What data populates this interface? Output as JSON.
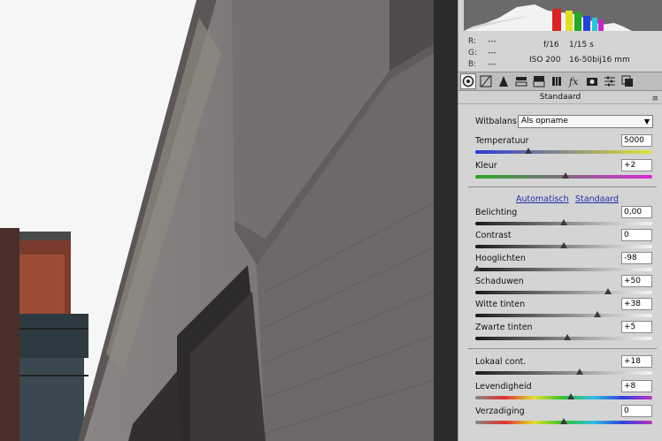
{
  "info": {
    "r_label": "R:",
    "g_label": "G:",
    "b_label": "B:",
    "r_val": "---",
    "g_val": "---",
    "b_val": "---",
    "aperture": "f/16",
    "shutter": "1/15 s",
    "iso": "ISO 200",
    "lens": "16-50bij16 mm"
  },
  "toolbar": {
    "icons": [
      "basic-icon",
      "tone-curve-icon",
      "detail-icon",
      "hsl-icon",
      "split-toning-icon",
      "lens-corrections-icon",
      "effects-icon",
      "camera-calibration-icon",
      "presets-icon",
      "snapshots-icon"
    ]
  },
  "tab": {
    "title": "Standaard",
    "menu": "≡"
  },
  "whitebalance": {
    "label": "Witbalans:",
    "value": "Als opname"
  },
  "sliders_wb": [
    {
      "label": "Temperatuur",
      "value": "5000",
      "pos": 0.3
    },
    {
      "label": "Kleur",
      "value": "+2",
      "pos": 0.51
    }
  ],
  "links": {
    "auto": "Automatisch",
    "default": "Standaard"
  },
  "sliders_tone": [
    {
      "label": "Belichting",
      "value": "0,00",
      "pos": 0.5
    },
    {
      "label": "Contrast",
      "value": "0",
      "pos": 0.5
    },
    {
      "label": "Hooglichten",
      "value": "-98",
      "pos": 0.01
    },
    {
      "label": "Schaduwen",
      "value": "+50",
      "pos": 0.75
    },
    {
      "label": "Witte tinten",
      "value": "+38",
      "pos": 0.69
    },
    {
      "label": "Zwarte tinten",
      "value": "+5",
      "pos": 0.52
    }
  ],
  "sliders_presence": [
    {
      "label": "Lokaal cont.",
      "value": "+18",
      "pos": 0.59
    },
    {
      "label": "Levendigheid",
      "value": "+8",
      "pos": 0.54
    },
    {
      "label": "Verzadiging",
      "value": "0",
      "pos": 0.5
    }
  ],
  "colors": {
    "panel": "#d4d4d4",
    "link": "#1d2fa8",
    "divider": "#2b2b2b"
  }
}
